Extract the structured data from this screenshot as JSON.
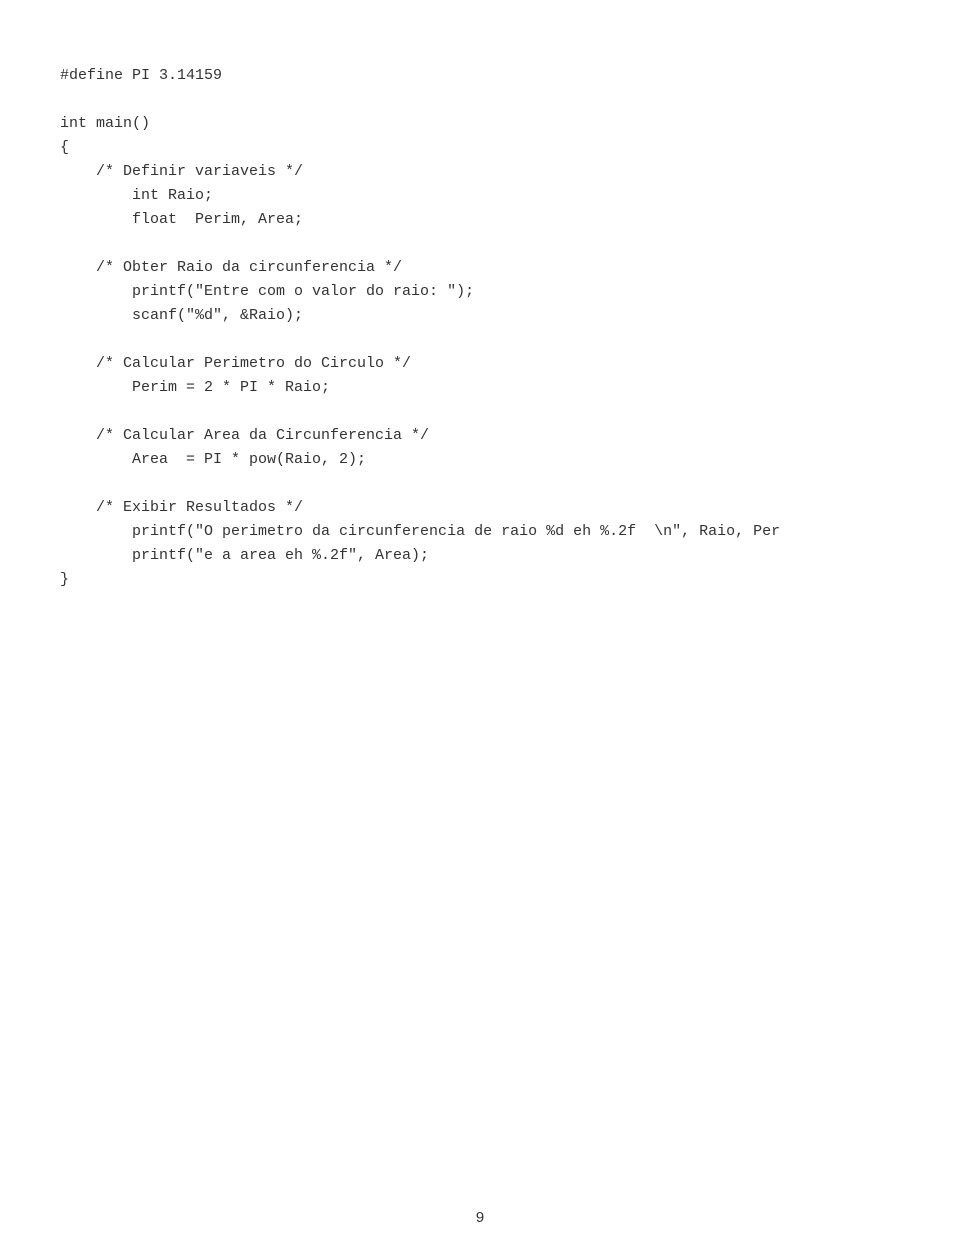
{
  "code": {
    "lines": [
      "#define PI 3.14159",
      "",
      "int main()",
      "{",
      "    /* Definir variaveis */",
      "        int Raio;",
      "        float  Perim, Area;",
      "",
      "    /* Obter Raio da circunferencia */",
      "        printf(\"Entre com o valor do raio: \");",
      "        scanf(\"%d\", &Raio);",
      "",
      "    /* Calcular Perimetro do Circulo */",
      "        Perim = 2 * PI * Raio;",
      "",
      "    /* Calcular Area da Circunferencia */",
      "        Area  = PI * pow(Raio, 2);",
      "",
      "    /* Exibir Resultados */",
      "        printf(\"O perimetro da circunferencia de raio %d eh %.2f  \\n\", Raio, Per",
      "        printf(\"e a area eh %.2f\", Area);",
      "}"
    ],
    "page_number": "9"
  }
}
